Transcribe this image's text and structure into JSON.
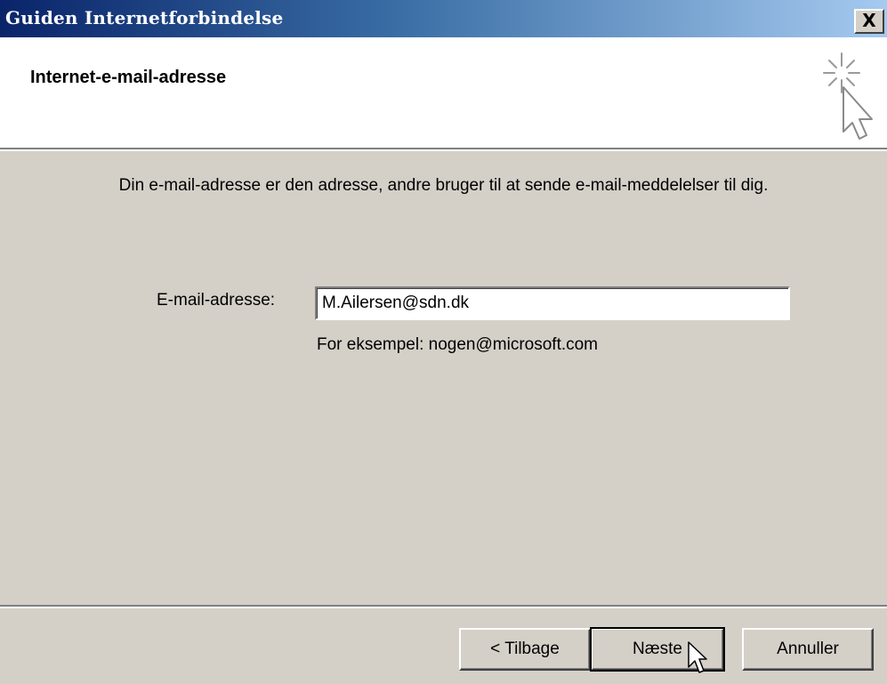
{
  "window": {
    "title": "Guiden Internetforbindelse",
    "close_label": "X"
  },
  "header": {
    "title": "Internet-e-mail-adresse",
    "icon": "wizard-cursor-icon"
  },
  "main": {
    "description": "Din e-mail-adresse er den adresse, andre bruger til at sende e-mail-meddelelser til dig.",
    "email_label": "E-mail-adresse:",
    "email_value": "M.Ailersen@sdn.dk",
    "example_text": "For eksempel: nogen@microsoft.com"
  },
  "buttons": {
    "back_label": "< Tilbage",
    "next_label": "Næste",
    "cancel_label": "Annuller"
  },
  "colors": {
    "titlebar_start": "#0a246a",
    "titlebar_end": "#a6caf0",
    "dialog_bg": "#d4d0c8"
  }
}
